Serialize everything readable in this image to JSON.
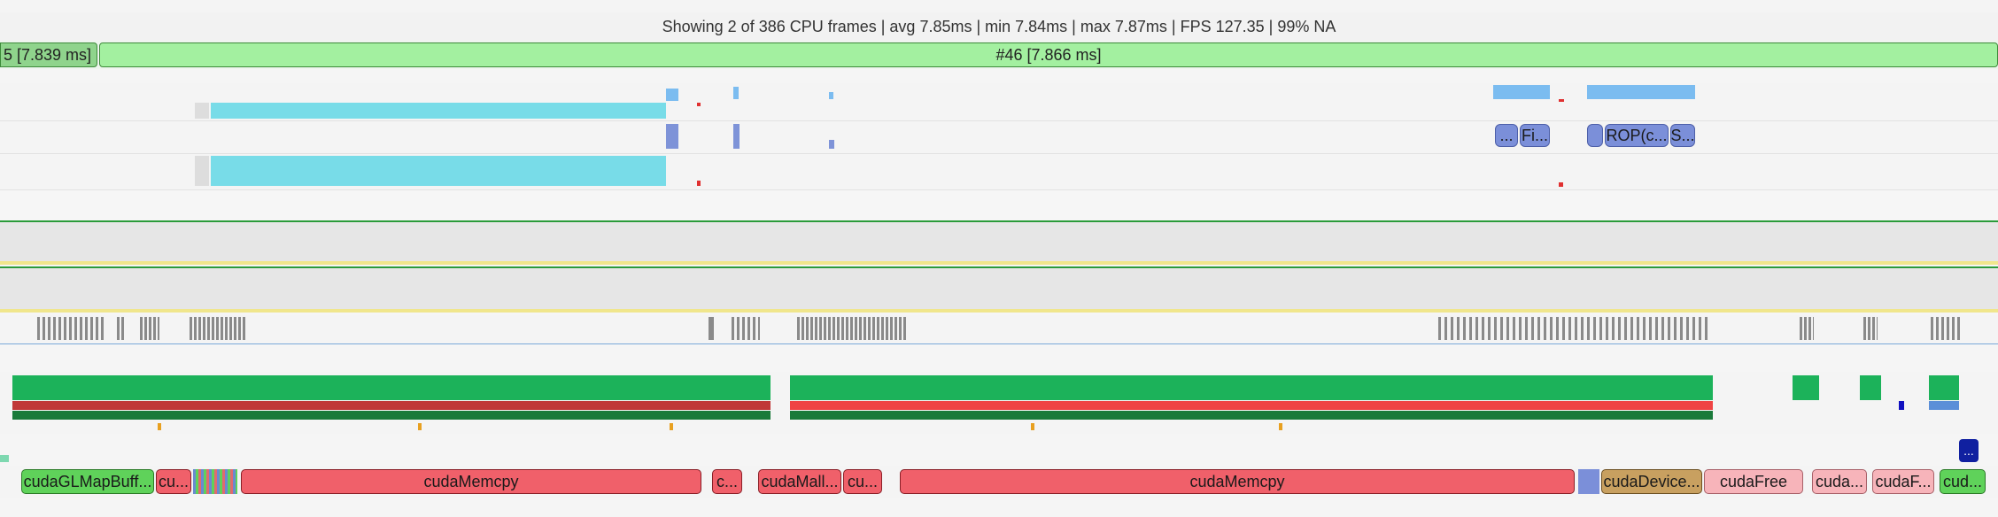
{
  "status": {
    "summary": "Showing 2 of 386 CPU frames | avg 7.85ms | min 7.84ms | max 7.87ms | FPS 127.35 | 99% NA"
  },
  "frames": {
    "prev_label": "5 [7.839 ms]",
    "current_label": "#46 [7.866 ms]"
  },
  "gpu_ranges": [
    {
      "label": "..."
    },
    {
      "label": "Fi..."
    },
    {
      "label": ""
    },
    {
      "label": "ROP(c..."
    },
    {
      "label": "S..."
    }
  ],
  "badge": {
    "label": "..."
  },
  "cuda_api": [
    {
      "label": "cudaGLMapBuff...",
      "color": "green"
    },
    {
      "label": "cu...",
      "color": "red"
    },
    {
      "label": "cudaMemcpy",
      "color": "red"
    },
    {
      "label": "c...",
      "color": "red"
    },
    {
      "label": "cudaMall...",
      "color": "red"
    },
    {
      "label": "cu...",
      "color": "red"
    },
    {
      "label": "cudaMemcpy",
      "color": "red"
    },
    {
      "label": "cudaDevice...",
      "color": "brown"
    },
    {
      "label": "cudaFree",
      "color": "pink"
    },
    {
      "label": "cuda...",
      "color": "pink"
    },
    {
      "label": "cudaF...",
      "color": "pink"
    },
    {
      "label": "cud...",
      "color": "green"
    }
  ]
}
